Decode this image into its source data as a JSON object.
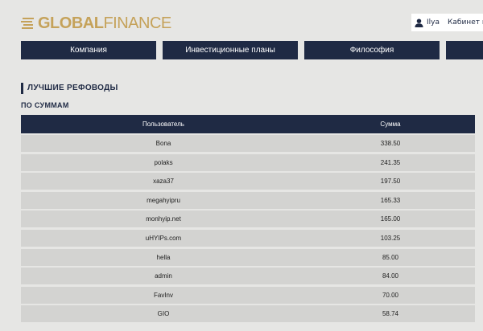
{
  "brand": {
    "part1": "GLOBAL",
    "part2": "FINANCE",
    "color": "#c5a25a"
  },
  "user": {
    "name": "Ilya",
    "cabinet_label": "Кабинет и"
  },
  "nav": [
    {
      "label": "Компания"
    },
    {
      "label": "Инвестиционные планы"
    },
    {
      "label": "Философия"
    },
    {
      "label": ""
    }
  ],
  "section": {
    "title": "ЛУЧШИЕ РЕФОВОДЫ",
    "subtitle": "ПО СУММАМ"
  },
  "table": {
    "headers": {
      "user": "Пользователь",
      "sum": "Сумма"
    },
    "rows": [
      {
        "user": "Bona",
        "sum": "338.50"
      },
      {
        "user": "polaks",
        "sum": "241.35"
      },
      {
        "user": "xaza37",
        "sum": "197.50"
      },
      {
        "user": "megahyipru",
        "sum": "165.33"
      },
      {
        "user": "monhyip.net",
        "sum": "165.00"
      },
      {
        "user": "uHYIPs.com",
        "sum": "103.25"
      },
      {
        "user": "hella",
        "sum": "85.00"
      },
      {
        "user": "admin",
        "sum": "84.00"
      },
      {
        "user": "FavInv",
        "sum": "70.00"
      },
      {
        "user": "GIO",
        "sum": "58.74"
      }
    ]
  },
  "colors": {
    "navy": "#1f2a44",
    "background": "#e6e6e4",
    "row": "#d3d3d1"
  }
}
